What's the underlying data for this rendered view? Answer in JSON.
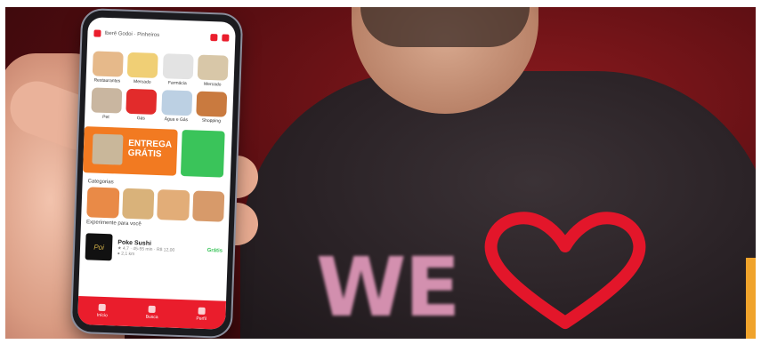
{
  "photo": {
    "shirt_text": "WE",
    "accent_colors": {
      "brand_red": "#ea1d2c",
      "heart_red": "#e3162a",
      "banner_orange": "#f27a21",
      "banner_green": "#3ac45a",
      "side_bar_yellow": "#f0a32b"
    }
  },
  "app": {
    "address": "Iberê Godoi · Pinheiros",
    "categories_grid": [
      {
        "label": "Restaurantes",
        "color": "#e6b98a"
      },
      {
        "label": "Mercado",
        "color": "#f0cf75"
      },
      {
        "label": "Farmácia",
        "color": "#e3e3e3"
      },
      {
        "label": "Mercado",
        "color": "#d8c7a8"
      },
      {
        "label": "Pet",
        "color": "#c9b6a0"
      },
      {
        "label": "Gás",
        "color": "#e22b2b"
      },
      {
        "label": "Água e Gás",
        "color": "#bcd0e3"
      },
      {
        "label": "Shopping",
        "color": "#c97a3f"
      }
    ],
    "banner": {
      "title_line1": "ENTREGA",
      "title_line2": "GRÁTIS"
    },
    "section_categories": "Categorias",
    "food_categories": [
      {
        "color": "#e98a47"
      },
      {
        "color": "#d9b27a"
      },
      {
        "color": "#e2ad78"
      },
      {
        "color": "#d79a6a"
      }
    ],
    "section_recommended": "Experimente para você",
    "restaurant": {
      "logo_text": "Poi",
      "name": "Poke Sushi",
      "meta_line1": "★ 4,7 · 45-55 min · R$ 12,00",
      "meta_line2": "● 2,1 km",
      "fee": "Grátis"
    },
    "bottom_nav": [
      {
        "label": "Início"
      },
      {
        "label": "Busca"
      },
      {
        "label": "Perfil"
      }
    ]
  }
}
